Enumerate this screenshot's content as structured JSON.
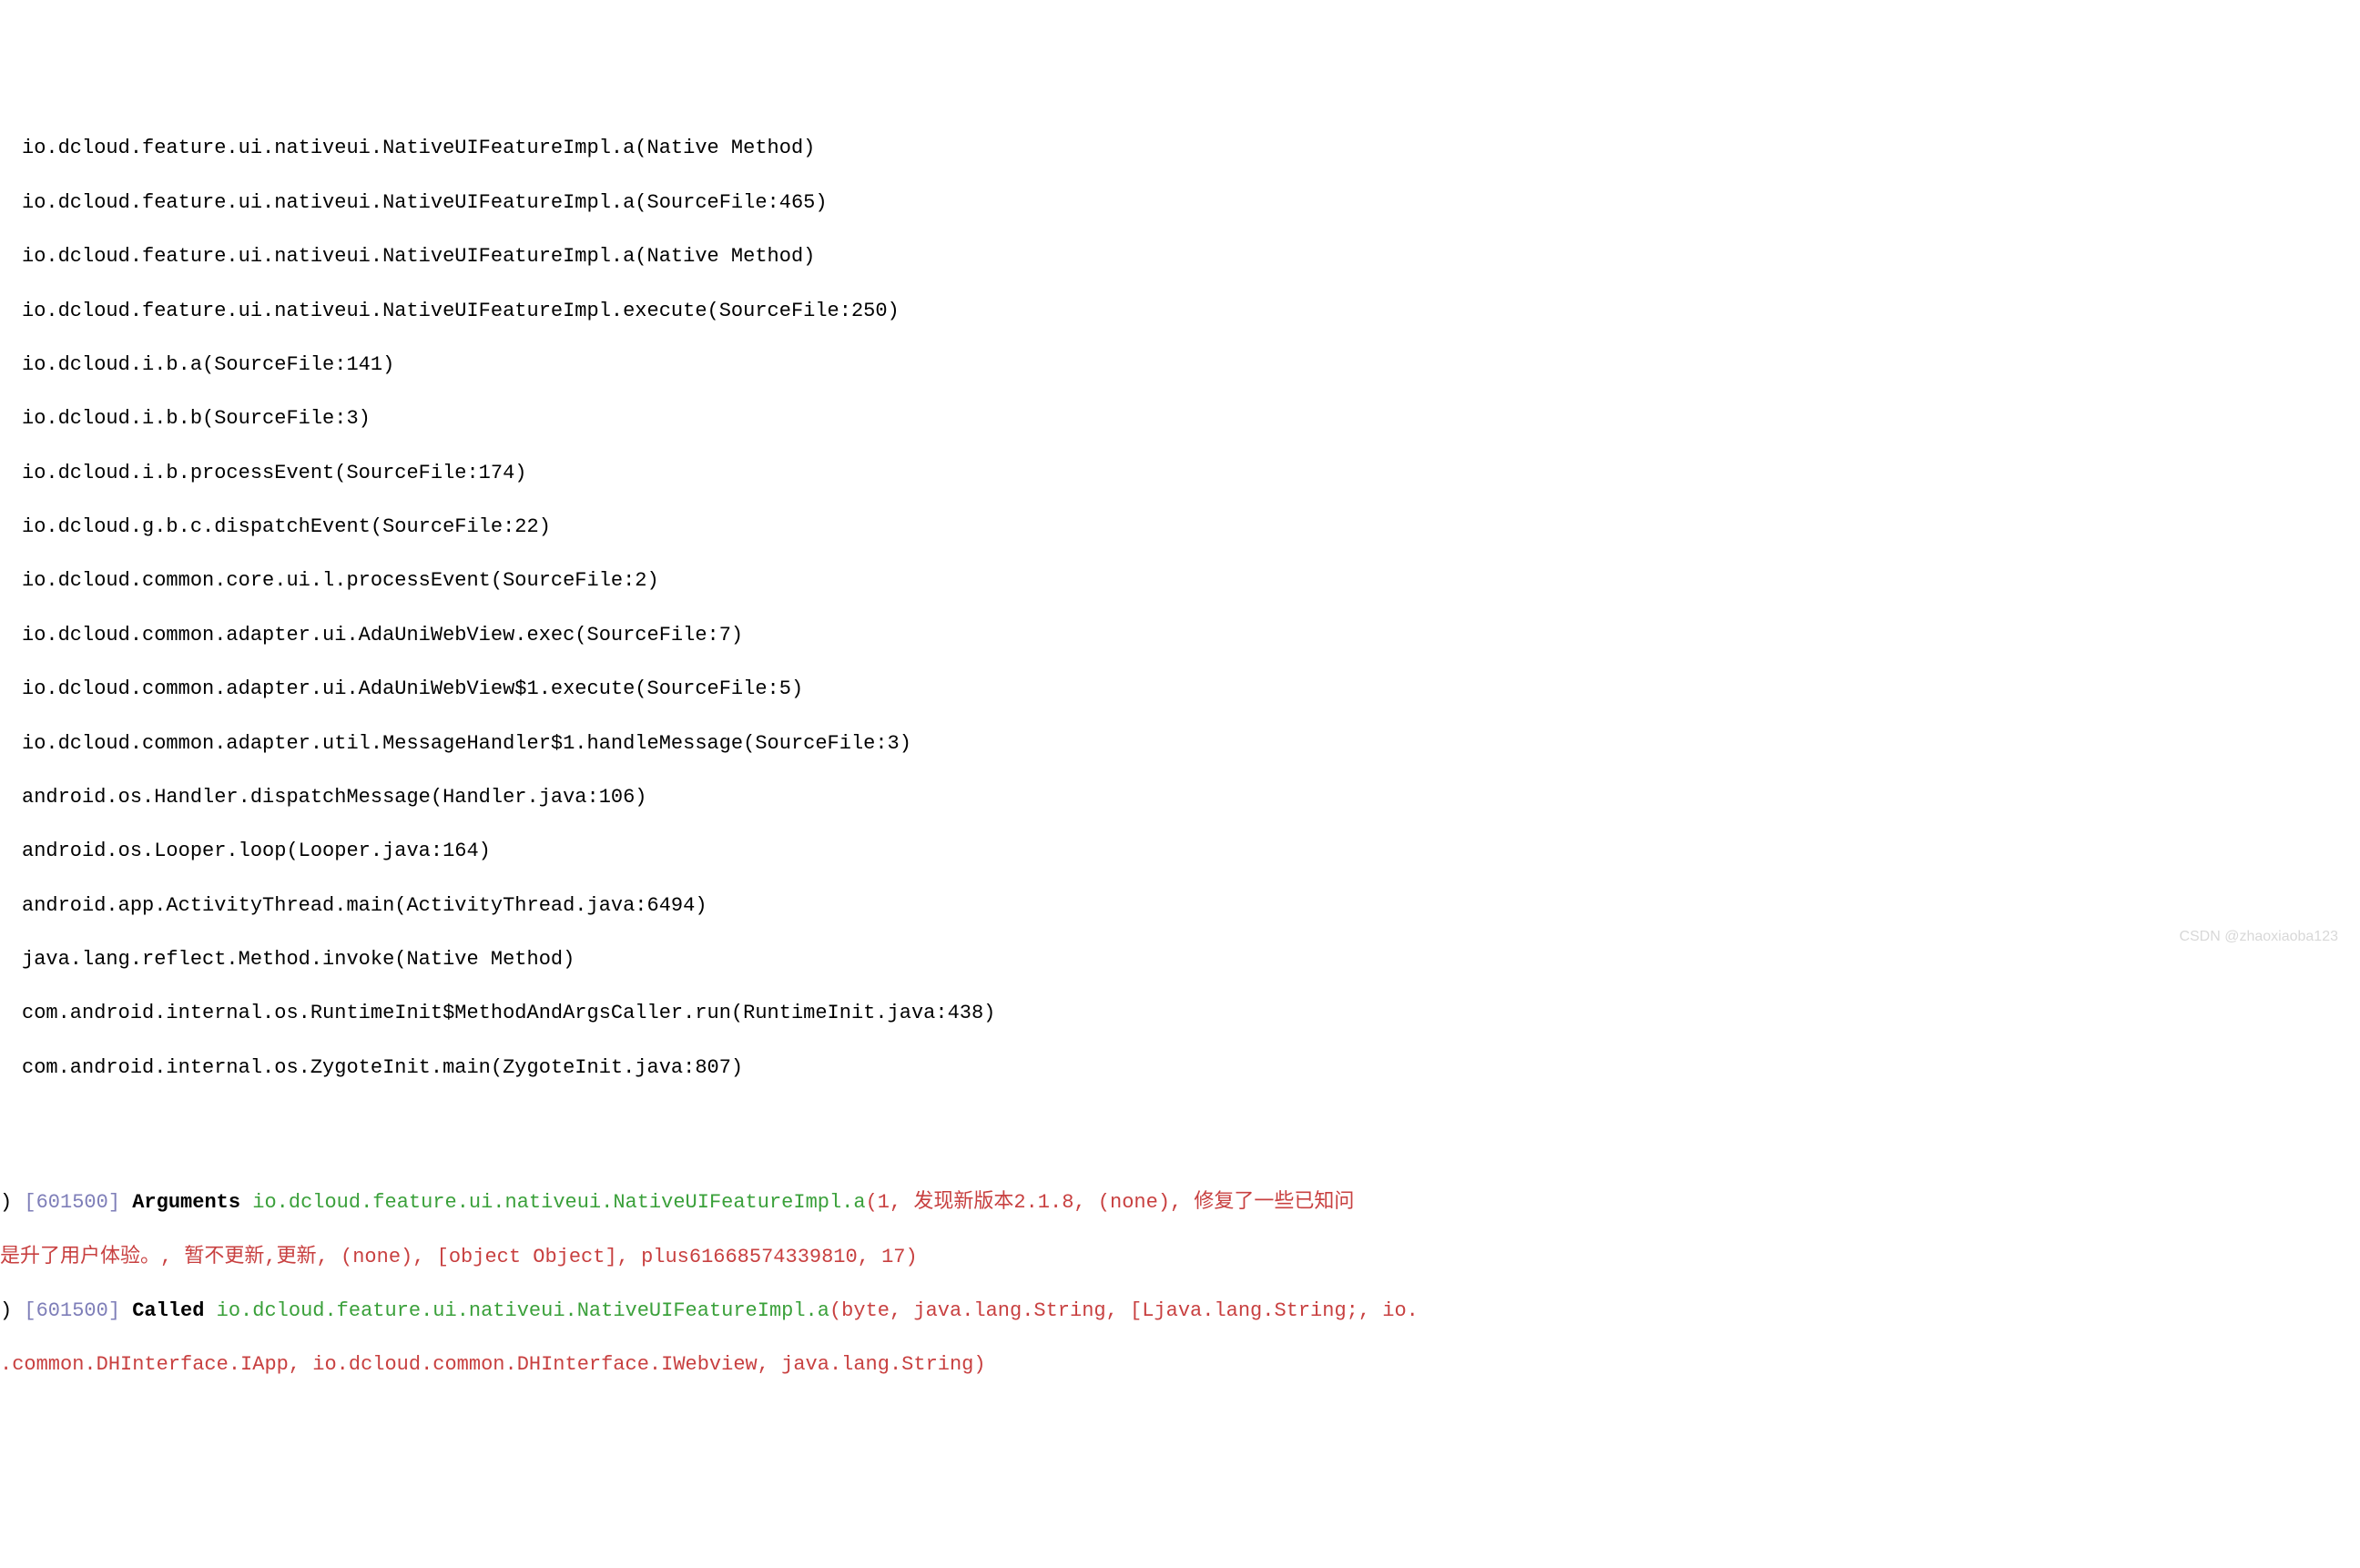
{
  "stack": [
    "io.dcloud.feature.ui.nativeui.NativeUIFeatureImpl.a(Native Method)",
    "io.dcloud.feature.ui.nativeui.NativeUIFeatureImpl.a(SourceFile:465)",
    "io.dcloud.feature.ui.nativeui.NativeUIFeatureImpl.a(Native Method)",
    "io.dcloud.feature.ui.nativeui.NativeUIFeatureImpl.execute(SourceFile:250)",
    "io.dcloud.i.b.a(SourceFile:141)",
    "io.dcloud.i.b.b(SourceFile:3)",
    "io.dcloud.i.b.processEvent(SourceFile:174)",
    "io.dcloud.g.b.c.dispatchEvent(SourceFile:22)",
    "io.dcloud.common.core.ui.l.processEvent(SourceFile:2)",
    "io.dcloud.common.adapter.ui.AdaUniWebView.exec(SourceFile:7)",
    "io.dcloud.common.adapter.ui.AdaUniWebView$1.execute(SourceFile:5)",
    "io.dcloud.common.adapter.util.MessageHandler$1.handleMessage(SourceFile:3)",
    "android.os.Handler.dispatchMessage(Handler.java:106)",
    "android.os.Looper.loop(Looper.java:164)",
    "android.app.ActivityThread.main(ActivityThread.java:6494)",
    "java.lang.reflect.Method.invoke(Native Method)",
    "com.android.internal.os.RuntimeInit$MethodAndArgsCaller.run(RuntimeInit.java:438)",
    "com.android.internal.os.ZygoteInit.main(ZygoteInit.java:807)"
  ],
  "logs": {
    "line1": {
      "prefix": ") ",
      "tag": "[601500]",
      "label": " Arguments ",
      "method": "io.dcloud.feature.ui.nativeui.NativeUIFeatureImpl.a",
      "open": "(",
      "args_row1": "1, 发现新版本2.1.8, (none), 修复了一些已知问",
      "args_row2": "是升了用户体验。, 暂不更新,更新, (none), [object Object], plus61668574339810, 17)"
    },
    "line2": {
      "prefix": ") ",
      "tag": "[601500]",
      "label": " Called ",
      "method": "io.dcloud.feature.ui.nativeui.NativeUIFeatureImpl.a",
      "open": "(",
      "args_row1": "byte, java.lang.String, [Ljava.lang.String;, io.",
      "args_row2": ".common.DHInterface.IApp, io.dcloud.common.DHInterface.IWebview, java.lang.String)"
    }
  },
  "watermark": "CSDN @zhaoxiaoba123"
}
